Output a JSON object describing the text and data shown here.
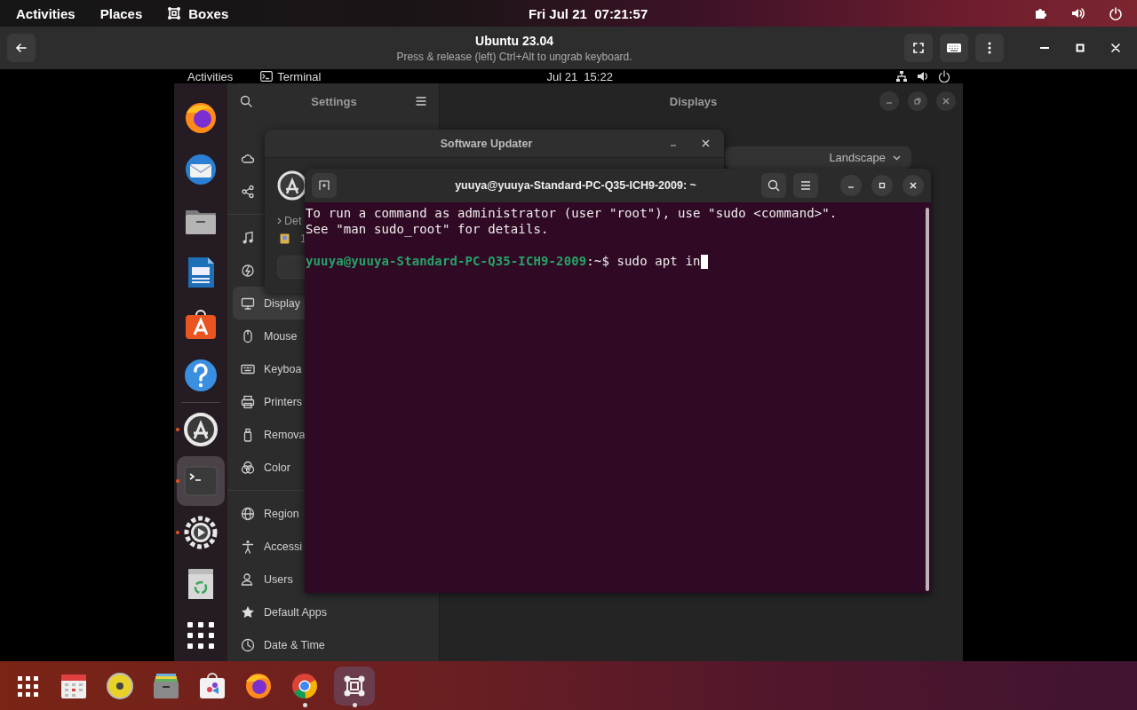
{
  "host_top_bar": {
    "activities": "Activities",
    "places": "Places",
    "app_name": "Boxes",
    "clock": "Fri Jul 21  07:21:57"
  },
  "boxes_header": {
    "title": "Ubuntu 23.04",
    "subtitle": "Press & release (left) Ctrl+Alt to ungrab keyboard."
  },
  "guest": {
    "top_bar": {
      "activities": "Activities",
      "app_name": "Terminal",
      "clock": "Jul 21  15:22"
    },
    "dock": [
      {
        "running": false,
        "selected": false
      },
      {
        "running": false,
        "selected": false
      },
      {
        "running": false,
        "selected": false
      },
      {
        "running": false,
        "selected": false
      },
      {
        "running": false,
        "selected": false
      },
      {
        "running": false,
        "selected": false
      },
      {
        "running": true,
        "selected": false
      },
      {
        "running": true,
        "selected": true
      },
      {
        "running": true,
        "selected": false
      },
      {
        "running": false,
        "selected": false
      },
      {
        "running": false,
        "selected": false
      }
    ],
    "settings": {
      "title": "Settings",
      "page_title": "Displays",
      "orientation": "Landscape",
      "sidebar_groups": [
        {
          "items": [
            {
              "selected": false
            },
            {
              "selected": false
            }
          ]
        },
        {
          "items": [
            {
              "selected": false
            },
            {
              "selected": false
            },
            {
              "label": "Display",
              "selected": true
            },
            {
              "label": "Mouse",
              "selected": false
            },
            {
              "label": "Keyboa",
              "selected": false
            },
            {
              "label": "Printers",
              "selected": false
            },
            {
              "label": "Remova",
              "selected": false
            },
            {
              "label": "Color",
              "selected": false
            }
          ]
        },
        {
          "items": [
            {
              "label": "Region",
              "selected": false
            },
            {
              "label": "Accessi",
              "selected": false
            },
            {
              "label": "Users",
              "selected": false
            },
            {
              "label": "Default Apps",
              "selected": false
            },
            {
              "label": "Date & Time",
              "selected": false
            }
          ]
        }
      ]
    },
    "software_updater": {
      "title": "Software Updater",
      "details": "Det",
      "item": "1"
    },
    "terminal": {
      "title": "yuuya@yuuya-Standard-PC-Q35-ICH9-2009: ~",
      "lines": [
        {
          "kind": "output",
          "text": "To run a command as administrator (user \"root\"), use \"sudo <command>\"."
        },
        {
          "kind": "output",
          "text": "See \"man sudo_root\" for details."
        },
        {
          "kind": "blank"
        },
        {
          "kind": "prompt",
          "user_host": "yuuya@yuuya-Standard-PC-Q35-ICH9-2009",
          "path": ":~$",
          "command": "sudo apt in"
        }
      ]
    }
  },
  "taskbar": [
    {
      "running": false,
      "selected": false
    },
    {
      "running": false,
      "selected": false
    },
    {
      "running": false,
      "selected": false
    },
    {
      "running": false,
      "selected": false
    },
    {
      "running": false,
      "selected": false
    },
    {
      "running": false,
      "selected": false
    },
    {
      "running": true,
      "selected": false
    },
    {
      "running": true,
      "selected": true
    }
  ]
}
